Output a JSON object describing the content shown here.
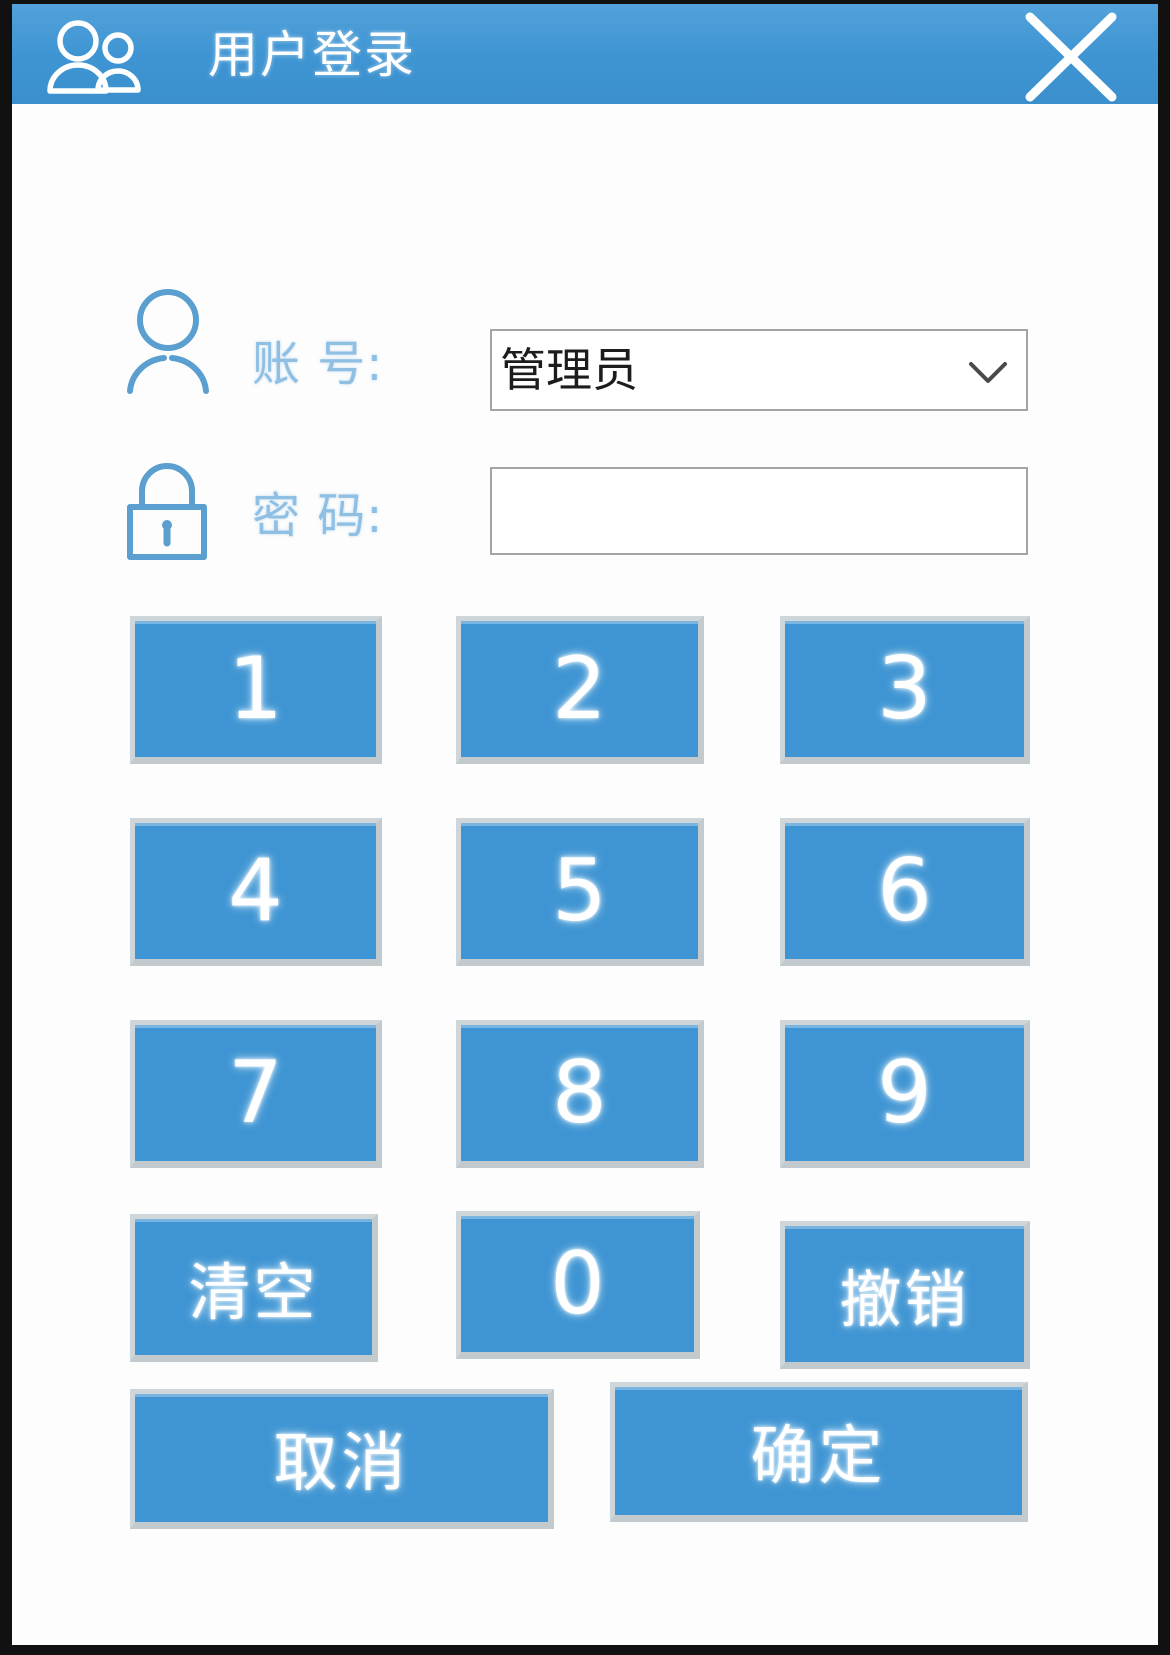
{
  "window": {
    "title": "用户登录",
    "title_icon": "users-icon",
    "close_icon": "close-icon",
    "titlebar_color": "#3f95d3",
    "accent_color": "#3f95d3",
    "button_border_color": "#cfd6da"
  },
  "form": {
    "account": {
      "icon": "person-icon",
      "label": "账  号:",
      "value": "管理员",
      "chevron_icon": "chevron-down-icon"
    },
    "password": {
      "icon": "lock-icon",
      "label": "密  码:",
      "value": "",
      "placeholder": ""
    }
  },
  "keypad": {
    "keys": [
      {
        "label": "1",
        "name": "key-1",
        "type": "digit"
      },
      {
        "label": "2",
        "name": "key-2",
        "type": "digit"
      },
      {
        "label": "3",
        "name": "key-3",
        "type": "digit"
      },
      {
        "label": "4",
        "name": "key-4",
        "type": "digit"
      },
      {
        "label": "5",
        "name": "key-5",
        "type": "digit"
      },
      {
        "label": "6",
        "name": "key-6",
        "type": "digit"
      },
      {
        "label": "7",
        "name": "key-7",
        "type": "digit"
      },
      {
        "label": "8",
        "name": "key-8",
        "type": "digit"
      },
      {
        "label": "9",
        "name": "key-9",
        "type": "digit"
      },
      {
        "label": "清空",
        "name": "key-clear",
        "type": "word"
      },
      {
        "label": "0",
        "name": "key-0",
        "type": "digit"
      },
      {
        "label": "撤销",
        "name": "key-undo",
        "type": "word"
      }
    ]
  },
  "actions": {
    "cancel_label": "取消",
    "confirm_label": "确定"
  }
}
